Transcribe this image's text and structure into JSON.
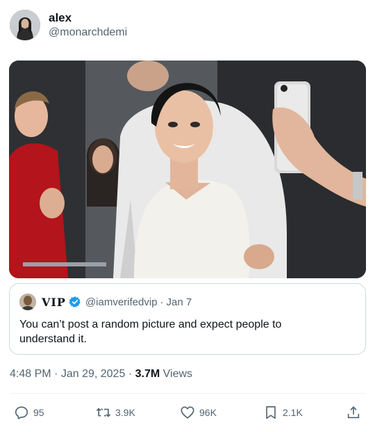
{
  "author": {
    "display_name": "alex",
    "handle": "@monarchdemi"
  },
  "quoted_post": {
    "display_name": "VIP",
    "handle": "@iamverifedvip",
    "separator": "·",
    "date": "Jan 7",
    "text": "You can’t post a random picture and expect people to understand it."
  },
  "meta": {
    "time": "4:48 PM",
    "separator1": "·",
    "date": "Jan 29, 2025",
    "separator2": "·",
    "views_count": "3.7M",
    "views_label": "Views"
  },
  "actions": {
    "replies": "95",
    "reposts": "3.9K",
    "likes": "96K",
    "bookmarks": "2.1K"
  },
  "colors": {
    "text_primary": "#0f1419",
    "text_secondary": "#536471",
    "border": "#cfd9de",
    "verified": "#1d9bf0"
  }
}
